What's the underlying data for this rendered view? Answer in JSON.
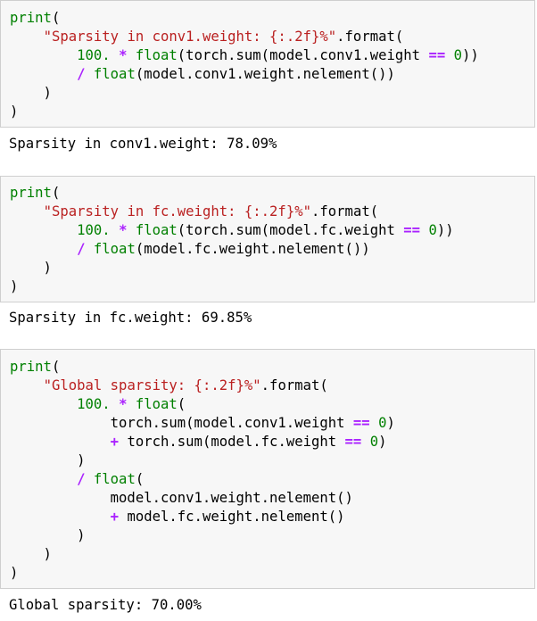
{
  "colors": {
    "builtin": "#008000",
    "string": "#ba2121",
    "number": "#008000",
    "operator": "#aa22ff",
    "text": "#000000",
    "cell_background": "#f7f7f7",
    "cell_border": "#cfcfcf"
  },
  "cells": [
    {
      "lines": [
        [
          [
            "b",
            "print"
          ],
          [
            "p",
            "("
          ]
        ],
        [
          [
            "p",
            "    "
          ],
          [
            "s",
            "\"Sparsity in conv1.weight: {:.2f}%\""
          ],
          [
            "p",
            ".format("
          ]
        ],
        [
          [
            "p",
            "        "
          ],
          [
            "n",
            "100."
          ],
          [
            "p",
            " "
          ],
          [
            "o",
            "*"
          ],
          [
            "p",
            " "
          ],
          [
            "b",
            "float"
          ],
          [
            "p",
            "(torch.sum(model.conv1.weight "
          ],
          [
            "o",
            "=="
          ],
          [
            "p",
            " "
          ],
          [
            "n",
            "0"
          ],
          [
            "p",
            "))"
          ]
        ],
        [
          [
            "p",
            "        "
          ],
          [
            "o",
            "/"
          ],
          [
            "p",
            " "
          ],
          [
            "b",
            "float"
          ],
          [
            "p",
            "(model.conv1.weight.nelement())"
          ]
        ],
        [
          [
            "p",
            "    )"
          ]
        ],
        [
          [
            "p",
            ")"
          ]
        ]
      ],
      "output": "Sparsity in conv1.weight: 78.09%"
    },
    {
      "lines": [
        [
          [
            "b",
            "print"
          ],
          [
            "p",
            "("
          ]
        ],
        [
          [
            "p",
            "    "
          ],
          [
            "s",
            "\"Sparsity in fc.weight: {:.2f}%\""
          ],
          [
            "p",
            ".format("
          ]
        ],
        [
          [
            "p",
            "        "
          ],
          [
            "n",
            "100."
          ],
          [
            "p",
            " "
          ],
          [
            "o",
            "*"
          ],
          [
            "p",
            " "
          ],
          [
            "b",
            "float"
          ],
          [
            "p",
            "(torch.sum(model.fc.weight "
          ],
          [
            "o",
            "=="
          ],
          [
            "p",
            " "
          ],
          [
            "n",
            "0"
          ],
          [
            "p",
            "))"
          ]
        ],
        [
          [
            "p",
            "        "
          ],
          [
            "o",
            "/"
          ],
          [
            "p",
            " "
          ],
          [
            "b",
            "float"
          ],
          [
            "p",
            "(model.fc.weight.nelement())"
          ]
        ],
        [
          [
            "p",
            "    )"
          ]
        ],
        [
          [
            "p",
            ")"
          ]
        ]
      ],
      "output": "Sparsity in fc.weight: 69.85%"
    },
    {
      "lines": [
        [
          [
            "b",
            "print"
          ],
          [
            "p",
            "("
          ]
        ],
        [
          [
            "p",
            "    "
          ],
          [
            "s",
            "\"Global sparsity: {:.2f}%\""
          ],
          [
            "p",
            ".format("
          ]
        ],
        [
          [
            "p",
            "        "
          ],
          [
            "n",
            "100."
          ],
          [
            "p",
            " "
          ],
          [
            "o",
            "*"
          ],
          [
            "p",
            " "
          ],
          [
            "b",
            "float"
          ],
          [
            "p",
            "("
          ]
        ],
        [
          [
            "p",
            "            torch.sum(model.conv1.weight "
          ],
          [
            "o",
            "=="
          ],
          [
            "p",
            " "
          ],
          [
            "n",
            "0"
          ],
          [
            "p",
            ")"
          ]
        ],
        [
          [
            "p",
            "            "
          ],
          [
            "o",
            "+"
          ],
          [
            "p",
            " torch.sum(model.fc.weight "
          ],
          [
            "o",
            "=="
          ],
          [
            "p",
            " "
          ],
          [
            "n",
            "0"
          ],
          [
            "p",
            ")"
          ]
        ],
        [
          [
            "p",
            "        )"
          ]
        ],
        [
          [
            "p",
            "        "
          ],
          [
            "o",
            "/"
          ],
          [
            "p",
            " "
          ],
          [
            "b",
            "float"
          ],
          [
            "p",
            "("
          ]
        ],
        [
          [
            "p",
            "            model.conv1.weight.nelement()"
          ]
        ],
        [
          [
            "p",
            "            "
          ],
          [
            "o",
            "+"
          ],
          [
            "p",
            " model.fc.weight.nelement()"
          ]
        ],
        [
          [
            "p",
            "        )"
          ]
        ],
        [
          [
            "p",
            "    )"
          ]
        ],
        [
          [
            "p",
            ")"
          ]
        ]
      ],
      "output": "Global sparsity: 70.00%"
    }
  ]
}
